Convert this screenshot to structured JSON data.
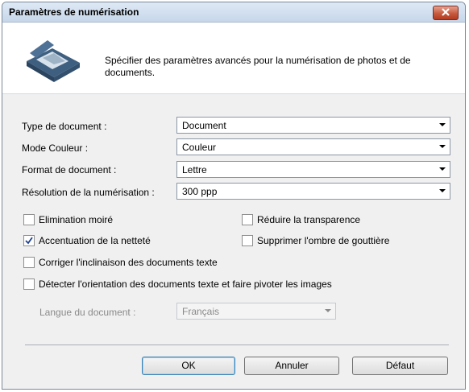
{
  "window": {
    "title": "Paramètres de numérisation"
  },
  "header": {
    "description": "Spécifier des paramètres avancés pour la numérisation de photos et de documents."
  },
  "fields": {
    "doc_type": {
      "label": "Type de document :",
      "value": "Document"
    },
    "color_mode": {
      "label": "Mode Couleur :",
      "value": "Couleur"
    },
    "doc_format": {
      "label": "Format de document :",
      "value": "Lettre"
    },
    "resolution": {
      "label": "Résolution de la numérisation :",
      "value": "300 ppp"
    },
    "language": {
      "label": "Langue du document :",
      "value": "Français"
    }
  },
  "options": {
    "moire": {
      "label": "Elimination moiré",
      "checked": false
    },
    "transparency": {
      "label": "Réduire la transparence",
      "checked": false
    },
    "sharpness": {
      "label": "Accentuation de la netteté",
      "checked": true
    },
    "gutter_shadow": {
      "label": "Supprimer l'ombre de gouttière",
      "checked": false
    },
    "skew": {
      "label": "Corriger l'inclinaison des documents texte",
      "checked": false
    },
    "orientation": {
      "label": "Détecter l'orientation des documents texte et faire pivoter les images",
      "checked": false
    }
  },
  "buttons": {
    "ok": "OK",
    "cancel": "Annuler",
    "default": "Défaut"
  },
  "colors": {
    "close_button": "#c75a3e",
    "default_button_border": "#3c7fb1",
    "titlebar": "#dfe9f5"
  },
  "icons": {
    "scanner": "scanner-icon",
    "close": "close-icon",
    "check": "checkmark-icon"
  }
}
